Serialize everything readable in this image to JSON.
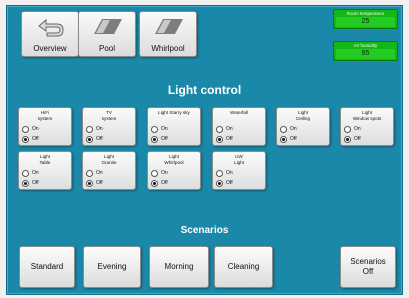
{
  "nav": [
    {
      "label": "Overview",
      "icon": "back-arrow-icon"
    },
    {
      "label": "Pool",
      "icon": "page-tile-icon"
    },
    {
      "label": "Whirlpool",
      "icon": "page-tile-icon"
    }
  ],
  "sensors": {
    "room_temperature": {
      "caption": "Room temperature",
      "value": "25"
    },
    "air_humidity": {
      "caption": "Air humidity",
      "value": "65"
    }
  },
  "light_control": {
    "title": "Light control",
    "on_label": "On",
    "off_label": "Off",
    "lights": [
      {
        "name": "HiFi\nsystem",
        "state": "Off"
      },
      {
        "name": "TV\nsystem",
        "state": "Off"
      },
      {
        "name": "Light Starry sky",
        "state": "Off"
      },
      {
        "name": "Waterfall",
        "state": "Off"
      },
      {
        "name": "Light\nCeiling",
        "state": "Off"
      },
      {
        "name": "Light\nWindow spots",
        "state": "Off"
      },
      {
        "name": "Light\nTable",
        "state": "Off"
      },
      {
        "name": "Light\nGranite",
        "state": "Off"
      },
      {
        "name": "Light\nWhirlpool",
        "state": "Off"
      },
      {
        "name": "UW\nLight",
        "state": "Off"
      }
    ]
  },
  "scenarios": {
    "title": "Scenarios",
    "buttons": [
      "Standard",
      "Evening",
      "Morning",
      "Cleaning",
      "Scenarios\nOff"
    ]
  },
  "colors": {
    "panel": "#1a88a8",
    "sensor_green": "#14b814",
    "title_text": "#ffffff"
  }
}
